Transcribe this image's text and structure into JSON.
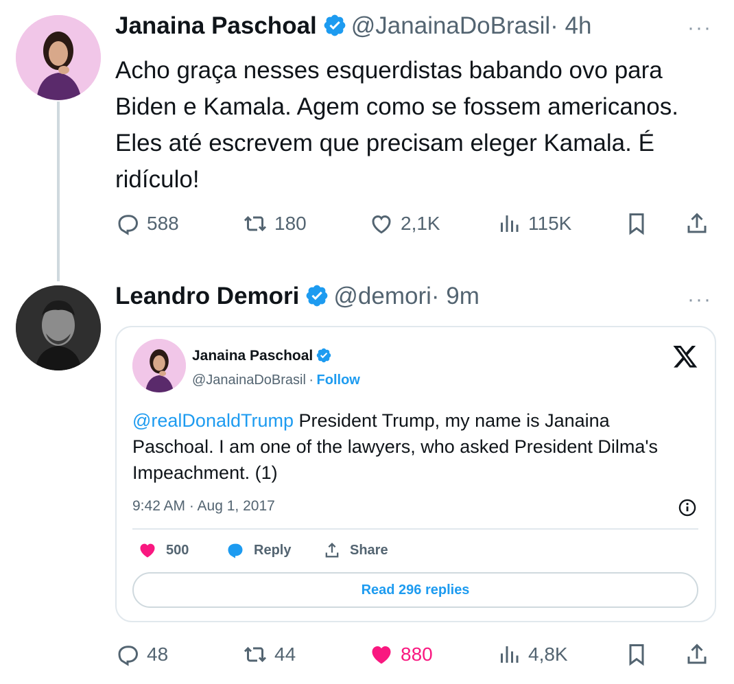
{
  "tweet1": {
    "name": "Janaina Paschoal",
    "handle": "@JanainaDoBrasil",
    "time": "· 4h",
    "text": "Acho graça nesses esquerdistas babando ovo para Biden e Kamala. Agem como se fossem americanos. Eles até escrevem que precisam eleger Kamala. É ridículo!",
    "more": "···",
    "replies": "588",
    "retweets": "180",
    "likes": "2,1K",
    "views": "115K"
  },
  "tweet2": {
    "name": "Leandro Demori",
    "handle": "@demori",
    "time": "· 9m",
    "more": "···",
    "replies": "48",
    "retweets": "44",
    "likes": "880",
    "views": "4,8K",
    "like_color": "#f91880"
  },
  "embed": {
    "name": "Janaina Paschoal",
    "handle": "@JanainaDoBrasil",
    "separator": "·",
    "follow": "Follow",
    "mention": "@realDonaldTrump",
    "text": " President Trump, my name is Janaina Paschoal. I am one of the lawyers, who asked President Dilma's Impeachment. (1)",
    "timestamp": "9:42 AM · Aug 1, 2017",
    "likes": "500",
    "reply_label": "Reply",
    "share_label": "Share",
    "read_replies": "Read 296 replies"
  },
  "colors": {
    "accent": "#1d9bf0",
    "like": "#f91880",
    "muted": "#536471",
    "text": "#0f1419"
  },
  "icons": [
    "verified-badge-icon",
    "more-icon",
    "reply-icon",
    "retweet-icon",
    "like-icon",
    "views-icon",
    "bookmark-icon",
    "share-icon",
    "x-logo-icon",
    "info-icon"
  ]
}
